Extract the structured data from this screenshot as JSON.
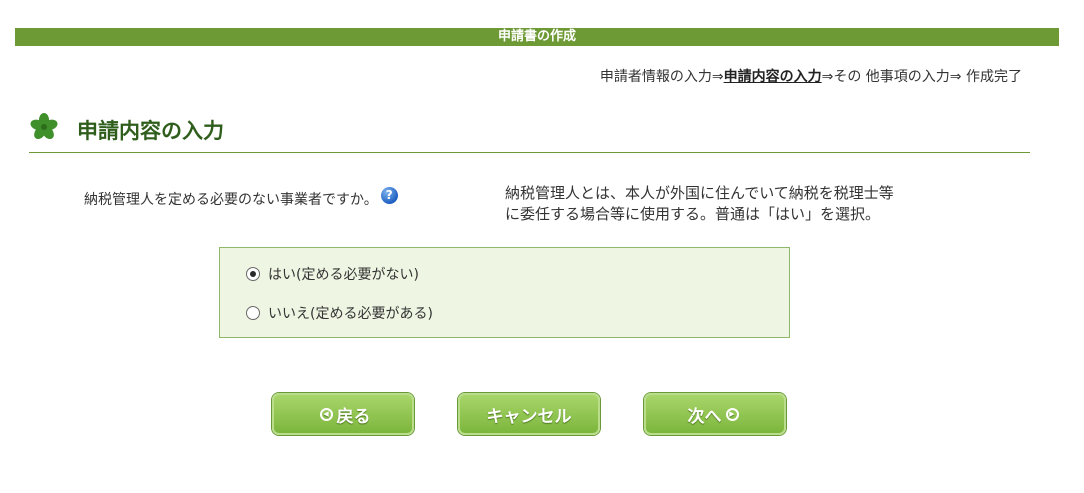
{
  "header": {
    "title": "申請書の作成"
  },
  "steps": {
    "before": "申請者情報の入力⇒",
    "current": "申請内容の入力",
    "after": "⇒その 他事項の入力⇒ 作成完了"
  },
  "section": {
    "title": "申請内容の入力"
  },
  "question": {
    "text": "納税管理人を定める必要のない事業者ですか。",
    "help_symbol": "?"
  },
  "explanation": {
    "line1": "納税管理人とは、本人が外国に住んでいて納税を税理士等",
    "line2": "に委任する場合等に使用する。普通は「はい」を選択。"
  },
  "options": [
    {
      "label": "はい(定める必要がない)",
      "selected": true
    },
    {
      "label": "いいえ(定める必要がある)",
      "selected": false
    }
  ],
  "buttons": {
    "back": "戻る",
    "cancel": "キャンセル",
    "next": "次へ"
  },
  "colors": {
    "accent": "#6e9a36",
    "heading_text": "#2f5e1c",
    "panel_bg": "#eef5e2",
    "button_top": "#a9d56a",
    "button_bottom": "#7bb63c"
  }
}
